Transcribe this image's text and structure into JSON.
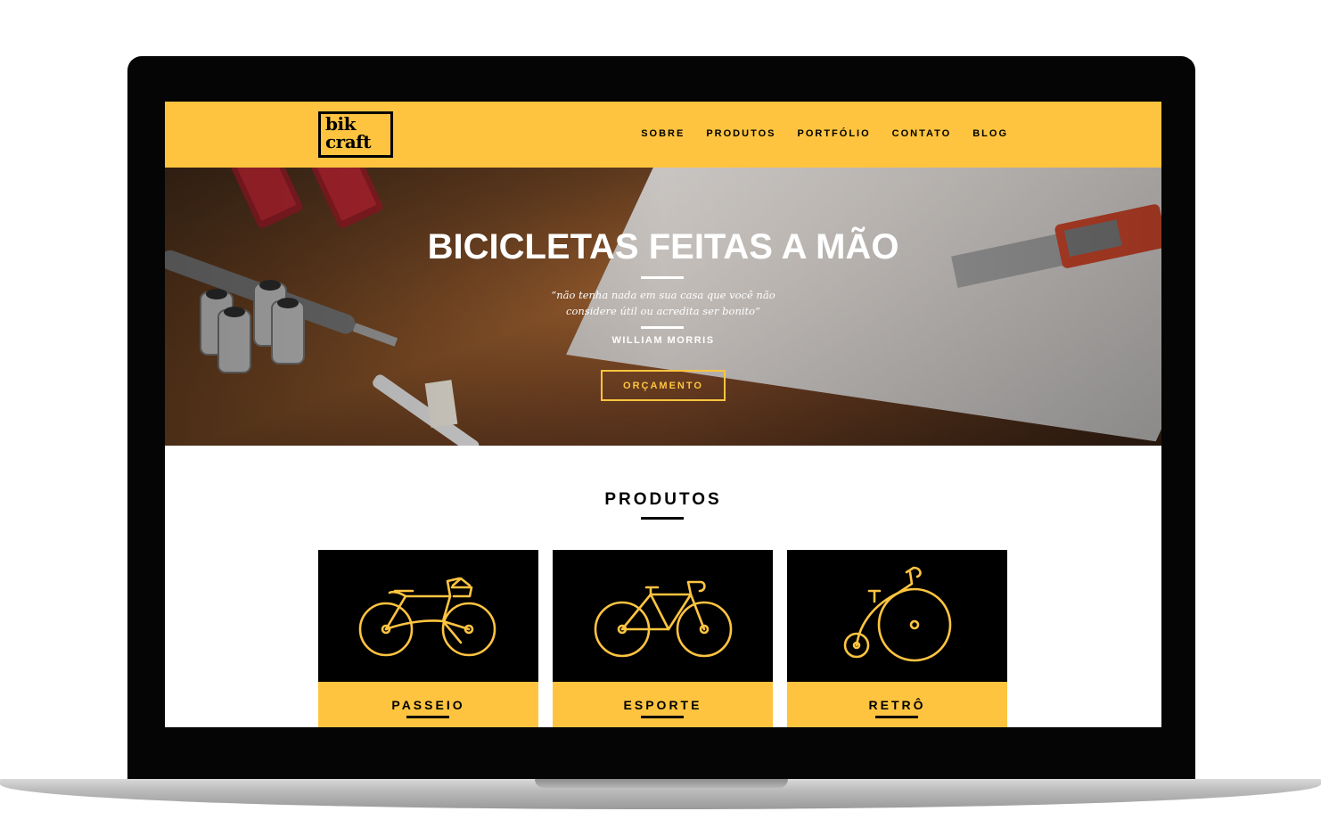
{
  "logo": {
    "line1": "bik",
    "line2": "craft"
  },
  "nav": {
    "items": [
      "SOBRE",
      "PRODUTOS",
      "PORTFÓLIO",
      "CONTATO",
      "BLOG"
    ]
  },
  "hero": {
    "title": "BICICLETAS FEITAS A MÃO",
    "quote": "“não tenha nada em sua casa que você não considere útil ou acredita ser bonito”",
    "author": "WILLIAM MORRIS",
    "button_label": "ORÇAMENTO"
  },
  "produtos": {
    "title": "PRODUTOS",
    "items": [
      {
        "label": "PASSEIO",
        "icon": "city-bike-icon"
      },
      {
        "label": "ESPORTE",
        "icon": "road-bike-icon"
      },
      {
        "label": "RETRÔ",
        "icon": "penny-farthing-icon"
      }
    ]
  },
  "colors": {
    "accent": "#fec440",
    "dark": "#000000",
    "light": "#ffffff"
  }
}
